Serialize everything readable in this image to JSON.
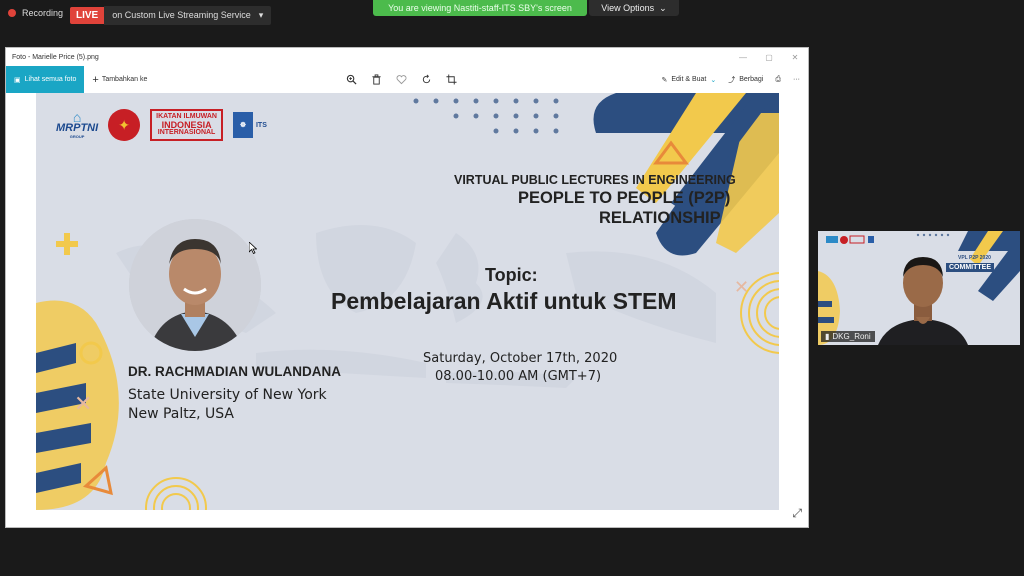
{
  "meeting": {
    "recording_label": "Recording",
    "live_label": "LIVE",
    "live_service": "on Custom Live Streaming Service",
    "share_banner": "You are viewing Nastiti-staff-ITS SBY's screen",
    "view_options": "View Options"
  },
  "photos_window": {
    "title": "Foto - Marielle Price (5).png",
    "see_all": "Lihat semua foto",
    "add_to": "Tambahkan ke",
    "edit_create": "Edit & Buat",
    "share": "Berbagi",
    "more": "···"
  },
  "slide": {
    "logos": {
      "mrptni": "MRPTNI",
      "mrptni_sub": "GROUP",
      "i4_line1": "IKATAN ILMUWAN",
      "i4_line2": "INDONESIA",
      "i4_line3": "INTERNASIONAL",
      "its": "ITS"
    },
    "event": "VIRTUAL PUBLIC LECTURES IN ENGINEERING",
    "series_line1": "PEOPLE TO PEOPLE (P2P)",
    "series_line2": "RELATIONSHIP",
    "topic_label": "Topic:",
    "topic_title": "Pembelajaran Aktif untuk STEM",
    "date": "Saturday, October 17th, 2020",
    "time": "08.00-10.00 AM (GMT+7)",
    "speaker_name": "DR. RACHMADIAN WULANDANA",
    "speaker_affiliation": "State University of New York",
    "speaker_location": "New Paltz, USA"
  },
  "participant": {
    "name": "DKG_Roni",
    "badge": "COMMITTEE",
    "tag": "VPL P2P 2020"
  },
  "colors": {
    "accent_navy": "#2c4e80",
    "accent_yellow": "#f2c94c",
    "live_red": "#e0433a",
    "banner_green": "#4cbb4c",
    "photos_accent": "#1aa6c5"
  }
}
